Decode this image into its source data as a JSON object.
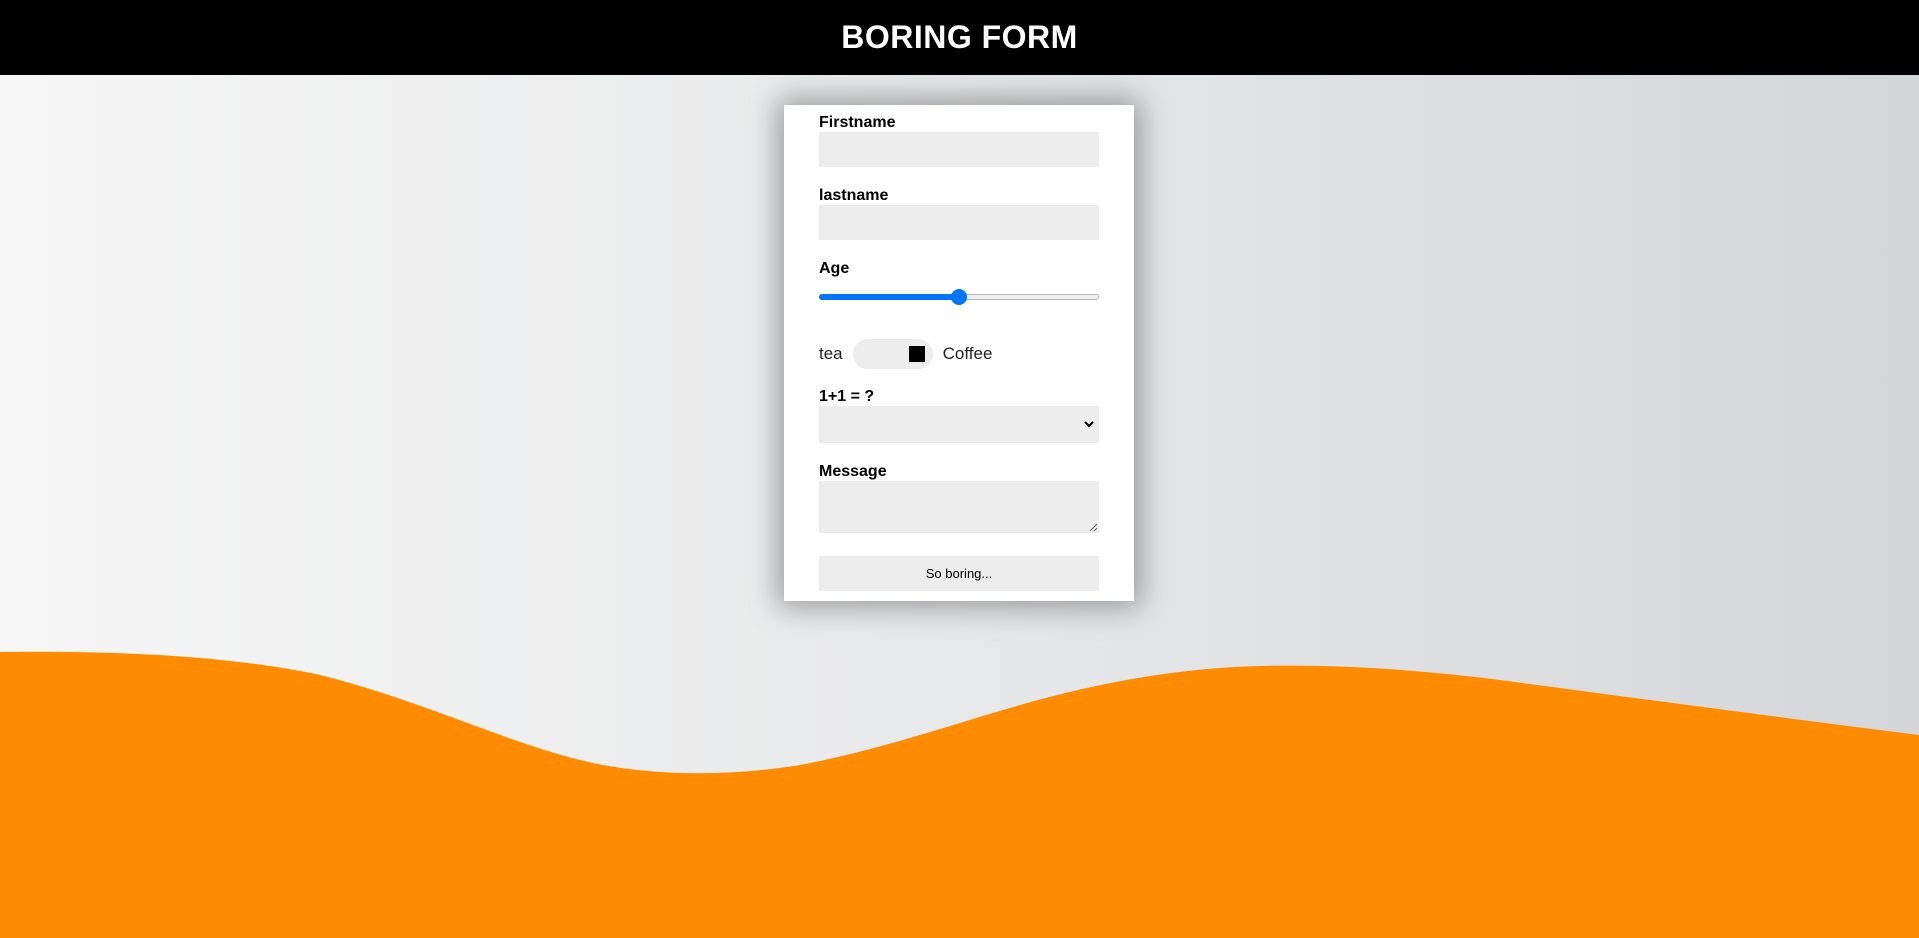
{
  "header": {
    "title": "BORING FORM"
  },
  "colors": {
    "header_bg": "#000000",
    "wave": "#ff8c00",
    "accent": "#0075ff"
  },
  "form": {
    "firstname_label": "Firstname",
    "firstname_value": "",
    "lastname_label": "lastname",
    "lastname_value": "",
    "age_label": "Age",
    "age_fraction": 0.5,
    "toggle_left_label": "tea",
    "toggle_right_label": "Coffee",
    "toggle_state": "Coffee",
    "select_label": "1+1 = ?",
    "select_value": "",
    "message_label": "Message",
    "message_value": "",
    "submit_label": "So boring..."
  },
  "icons": {
    "select_arrow": "chevron-down-icon",
    "resize": "resize-grip-icon"
  }
}
